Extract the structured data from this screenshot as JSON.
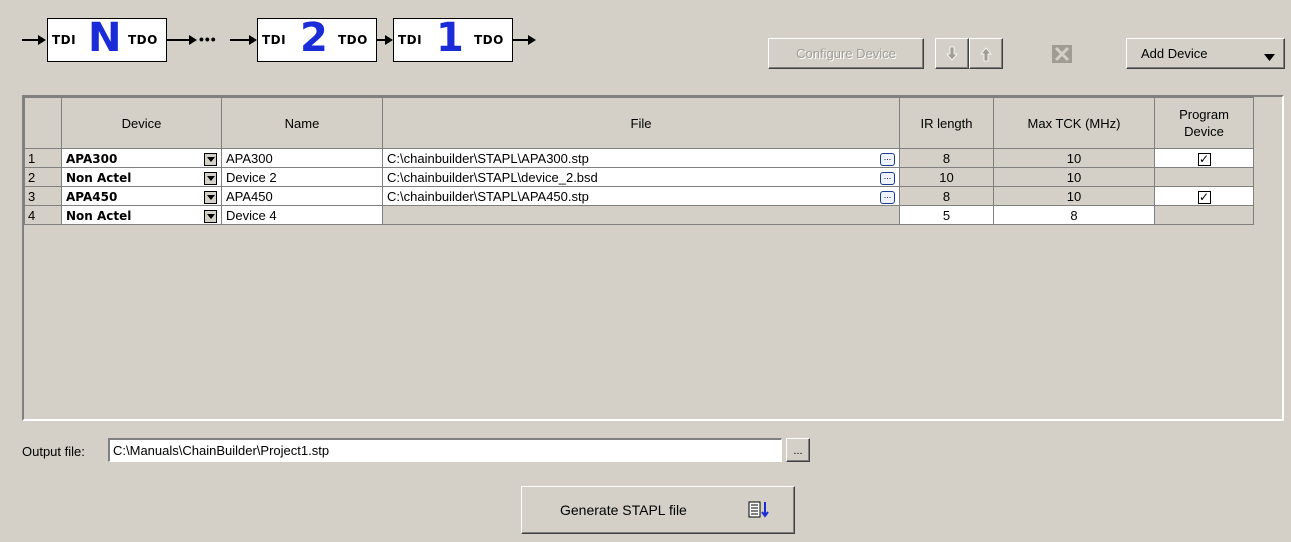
{
  "chain": {
    "pin_in": "TDI",
    "pin_out": "TDO",
    "devices": [
      "N",
      "2",
      "1"
    ],
    "ellipsis": "•••",
    "accent": "#1a2bd8"
  },
  "toolbar": {
    "configure_label": "Configure Device",
    "add_label": "Add Device",
    "icons": [
      "arrow-down-icon",
      "arrow-up-icon",
      "delete-icon",
      "chevron-down-icon"
    ]
  },
  "grid": {
    "columns": [
      "Device",
      "Name",
      "File",
      "IR length",
      "Max TCK (MHz)",
      "Program Device"
    ],
    "rows": [
      {
        "num": "1",
        "device": "APA300",
        "name": "APA300",
        "file": "C:\\chainbuilder\\STAPL\\APA300.stp",
        "ir": "8",
        "tck": "10",
        "program": true
      },
      {
        "num": "2",
        "device": "Non Actel",
        "name": "Device 2",
        "file": "C:\\chainbuilder\\STAPL\\device_2.bsd",
        "ir": "10",
        "tck": "10",
        "program": null
      },
      {
        "num": "3",
        "device": "APA450",
        "name": "APA450",
        "file": "C:\\chainbuilder\\STAPL\\APA450.stp",
        "ir": "8",
        "tck": "10",
        "program": true
      },
      {
        "num": "4",
        "device": "Non Actel",
        "name": "Device 4",
        "file": "",
        "ir": "5",
        "tck": "8",
        "program": null
      }
    ]
  },
  "output": {
    "label": "Output file:",
    "value": "C:\\Manuals\\ChainBuilder\\Project1.stp",
    "browse_label": "..."
  },
  "generate": {
    "label": "Generate STAPL file"
  }
}
